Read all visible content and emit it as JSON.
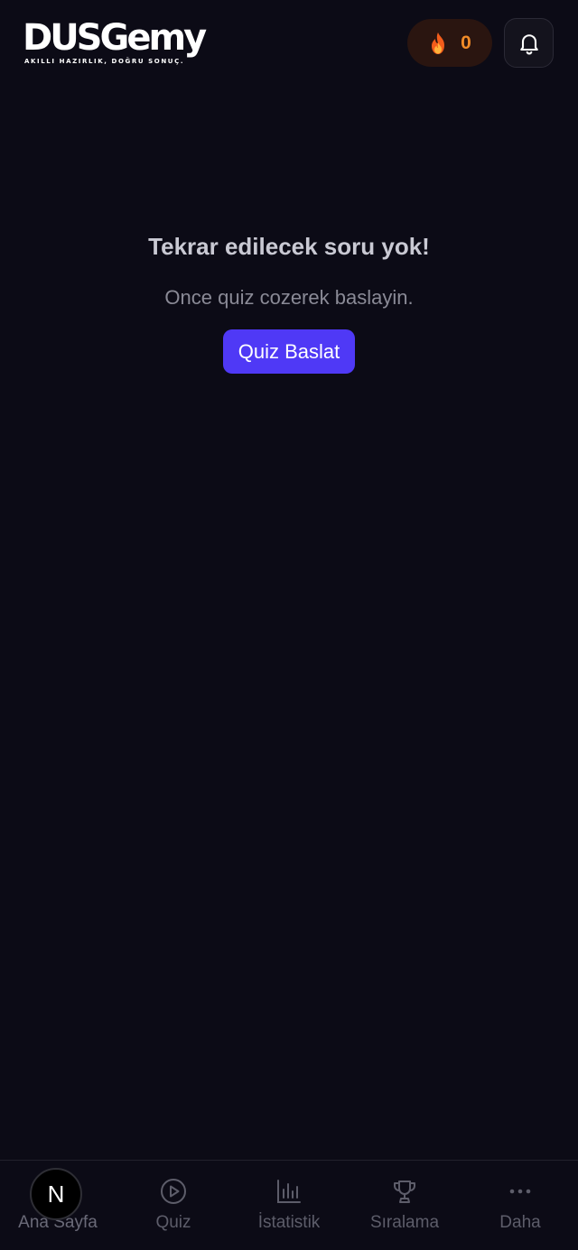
{
  "header": {
    "logo_text": "DUSGemy",
    "logo_tagline": "AKILLI HAZIRLIK, DOĞRU SONUÇ.",
    "streak_icon": "fire-icon",
    "streak_count": "0",
    "notification_icon": "bell-icon"
  },
  "empty_state": {
    "title": "Tekrar edilecek soru yok!",
    "subtitle": "Once quiz cozerek baslayin.",
    "button_label": "Quiz Baslat"
  },
  "bottom_nav": {
    "items": [
      {
        "label": "Ana Sayfa",
        "icon": "home-icon",
        "active": true
      },
      {
        "label": "Quiz",
        "icon": "play-circle-icon",
        "active": false
      },
      {
        "label": "İstatistik",
        "icon": "bar-chart-icon",
        "active": false
      },
      {
        "label": "Sıralama",
        "icon": "trophy-icon",
        "active": false
      },
      {
        "label": "Daha",
        "icon": "more-dots-icon",
        "active": false
      }
    ],
    "overlay_badge": "N"
  },
  "colors": {
    "background": "#0c0b16",
    "accent": "#4f39f6",
    "streak": "#f28c28"
  }
}
